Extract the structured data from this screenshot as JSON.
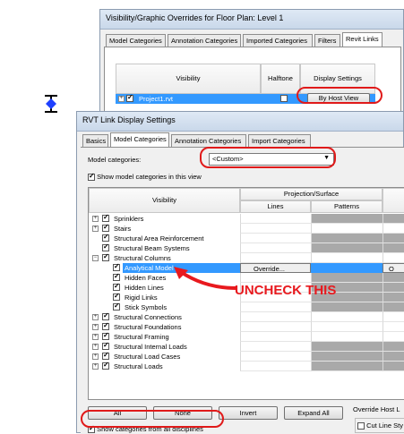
{
  "vg_dialog": {
    "title": "Visibility/Graphic Overrides for Floor Plan: Level 1",
    "tabs": [
      "Model Categories",
      "Annotation Categories",
      "Imported Categories",
      "Filters",
      "Revit Links"
    ],
    "columns": {
      "visibility": "Visibility",
      "halftone": "Halftone",
      "display_settings": "Display Settings"
    },
    "link_row": {
      "name": "Project1.rvt",
      "button": "By Host View"
    }
  },
  "rvt_dialog": {
    "title": "RVT Link Display Settings",
    "tabs": [
      "Basics",
      "Model Categories",
      "Annotation Categories",
      "Import Categories"
    ],
    "model_categories_label": "Model categories:",
    "model_categories_value": "<Custom>",
    "show_in_view_label": "Show model categories in this view",
    "table": {
      "visibility_header": "Visibility",
      "projection_header": "Projection/Surface",
      "lines_header": "Lines",
      "patterns_header": "Patterns"
    },
    "rows": [
      {
        "label": "Sprinklers"
      },
      {
        "label": "Stairs"
      },
      {
        "label": "Structural Area Reinforcement"
      },
      {
        "label": "Structural Beam Systems"
      },
      {
        "label": "Structural Columns"
      },
      {
        "label": "Analytical Model",
        "override": "Override..."
      },
      {
        "label": "Hidden Faces"
      },
      {
        "label": "Hidden Lines"
      },
      {
        "label": "Rigid Links"
      },
      {
        "label": "Stick Symbols"
      },
      {
        "label": "Structural Connections"
      },
      {
        "label": "Structural Foundations"
      },
      {
        "label": "Structural Framing"
      },
      {
        "label": "Structural Internal Loads"
      },
      {
        "label": "Structural Load Cases"
      },
      {
        "label": "Structural Loads"
      }
    ],
    "buttons": {
      "all": "All",
      "none": "None",
      "invert": "Invert",
      "expand_all": "Expand All"
    },
    "show_all_disciplines_label": "Show categories from all disciplines",
    "override_host_label": "Override Host L",
    "cut_line_label": "Cut Line Sty"
  },
  "annotation": {
    "text": "UNCHECK THIS",
    "color": "#e8191e"
  },
  "colors": {
    "oval": "#e01a1a",
    "selection": "#3399ff"
  }
}
